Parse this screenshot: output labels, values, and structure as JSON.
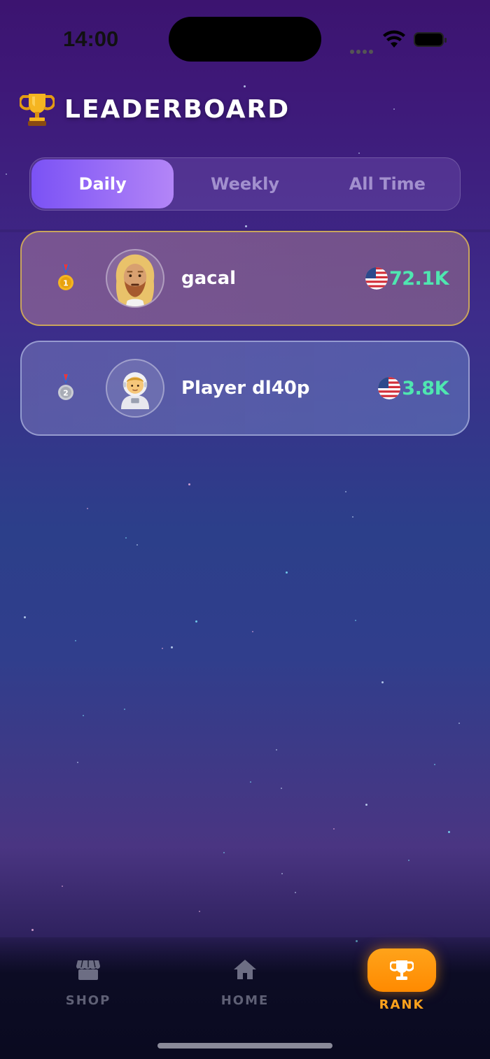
{
  "status_bar": {
    "time": "14:00"
  },
  "header": {
    "title": "LEADERBOARD",
    "icon": "trophy-icon"
  },
  "tabs": [
    {
      "label": "Daily",
      "active": true
    },
    {
      "label": "Weekly",
      "active": false
    },
    {
      "label": "All Time",
      "active": false
    }
  ],
  "leaderboard": [
    {
      "rank": 1,
      "medal": "gold-medal-icon",
      "avatar": "bearded-man-avatar",
      "name": "gacal",
      "flag": "us-flag-icon",
      "score": "72.1K"
    },
    {
      "rank": 2,
      "medal": "silver-medal-icon",
      "avatar": "astronaut-avatar",
      "name": "Player dl40p",
      "flag": "us-flag-icon",
      "score": "3.8K"
    }
  ],
  "bottom_nav": [
    {
      "label": "SHOP",
      "icon": "shop-icon",
      "active": false
    },
    {
      "label": "HOME",
      "icon": "home-icon",
      "active": false
    },
    {
      "label": "RANK",
      "icon": "trophy-icon",
      "active": true
    }
  ],
  "colors": {
    "accent_purple": "#7b52f5",
    "score_green": "#4fe6b0",
    "rank_orange": "#ffa31a",
    "gold_border": "#c9a45c"
  }
}
